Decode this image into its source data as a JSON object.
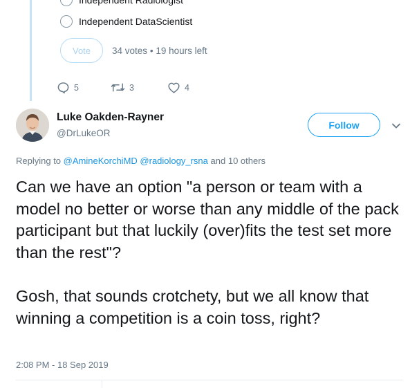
{
  "poll": {
    "partial_option": "Independent Radiologist",
    "option": "Independent DataScientist",
    "vote_label": "Vote",
    "votes": "34 votes",
    "separator": "•",
    "time_left": "19 hours left"
  },
  "parent_actions": {
    "replies": "5",
    "retweets": "3",
    "likes": "4",
    "icons": [
      "reply-icon",
      "retweet-icon",
      "like-icon"
    ]
  },
  "author": {
    "name": "Luke Oakden-Rayner",
    "handle": "@DrLukeOR",
    "follow_label": "Follow"
  },
  "replying": {
    "prefix": "Replying to",
    "mention_1": "@AmineKorchiMD",
    "mention_2": "@radiology_rsna",
    "suffix": "and 10 others"
  },
  "tweet": {
    "paragraph_1": "Can we have an option \"a person or team with a model no better or worse than any middle of the pack participant but that luckily (over)fits the test set more than the rest\"?",
    "paragraph_2": "Gosh, that sounds crotchety, but we all know that winning a competition is a coin toss, right?",
    "timestamp": "2:08 PM - 18 Sep 2019"
  },
  "colors": {
    "accent": "#1da1f2",
    "link": "#1b95e0",
    "muted": "#657786",
    "thread_line": "#c4e3f6"
  }
}
